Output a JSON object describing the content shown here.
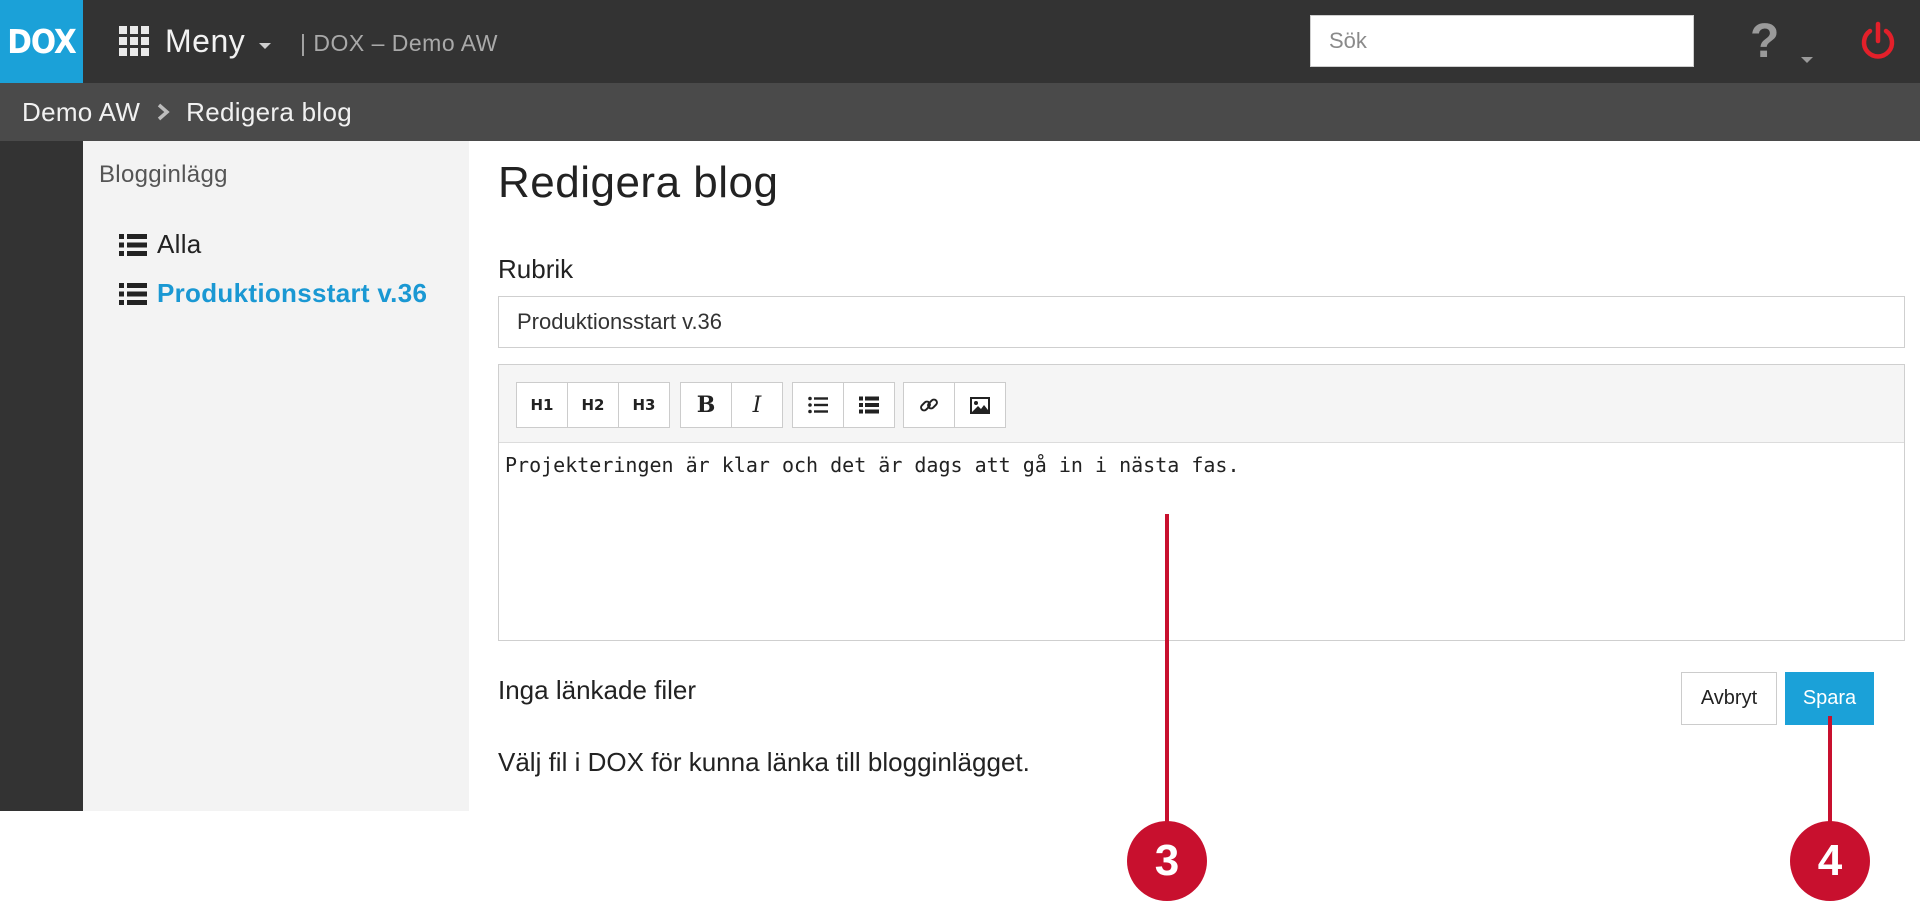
{
  "header": {
    "logo": "DOX",
    "menu_label": "Meny",
    "app_title": "| DOX – Demo AW",
    "search_placeholder": "Sök",
    "help_glyph": "?"
  },
  "breadcrumb": [
    {
      "label": "Demo AW"
    },
    {
      "label": "Redigera blog"
    }
  ],
  "sidebar": {
    "title": "Blogginlägg",
    "items": [
      {
        "label": "Alla",
        "active": false
      },
      {
        "label": "Produktionsstart v.36",
        "active": true
      }
    ]
  },
  "main": {
    "page_title": "Redigera blog",
    "rubrik_label": "Rubrik",
    "rubrik_value": "Produktionsstart v.36",
    "toolbar": {
      "h1": "H1",
      "h2": "H2",
      "h3": "H3",
      "bold": "B",
      "italic": "I"
    },
    "editor_text": "Projekteringen är klar och det är dags att gå in i nästa fas.",
    "linked_files": "Inga länkade filer",
    "hint": "Välj fil i DOX för kunna länka till blogginlägget.",
    "cancel_label": "Avbryt",
    "save_label": "Spara"
  },
  "callouts": [
    {
      "number": "3"
    },
    {
      "number": "4"
    }
  ],
  "colors": {
    "accent": "#1ba1d8",
    "topbar": "#333333",
    "breadcrumb_bar": "#4a4a4a",
    "callout": "#c8102e",
    "power": "#e3202a"
  }
}
